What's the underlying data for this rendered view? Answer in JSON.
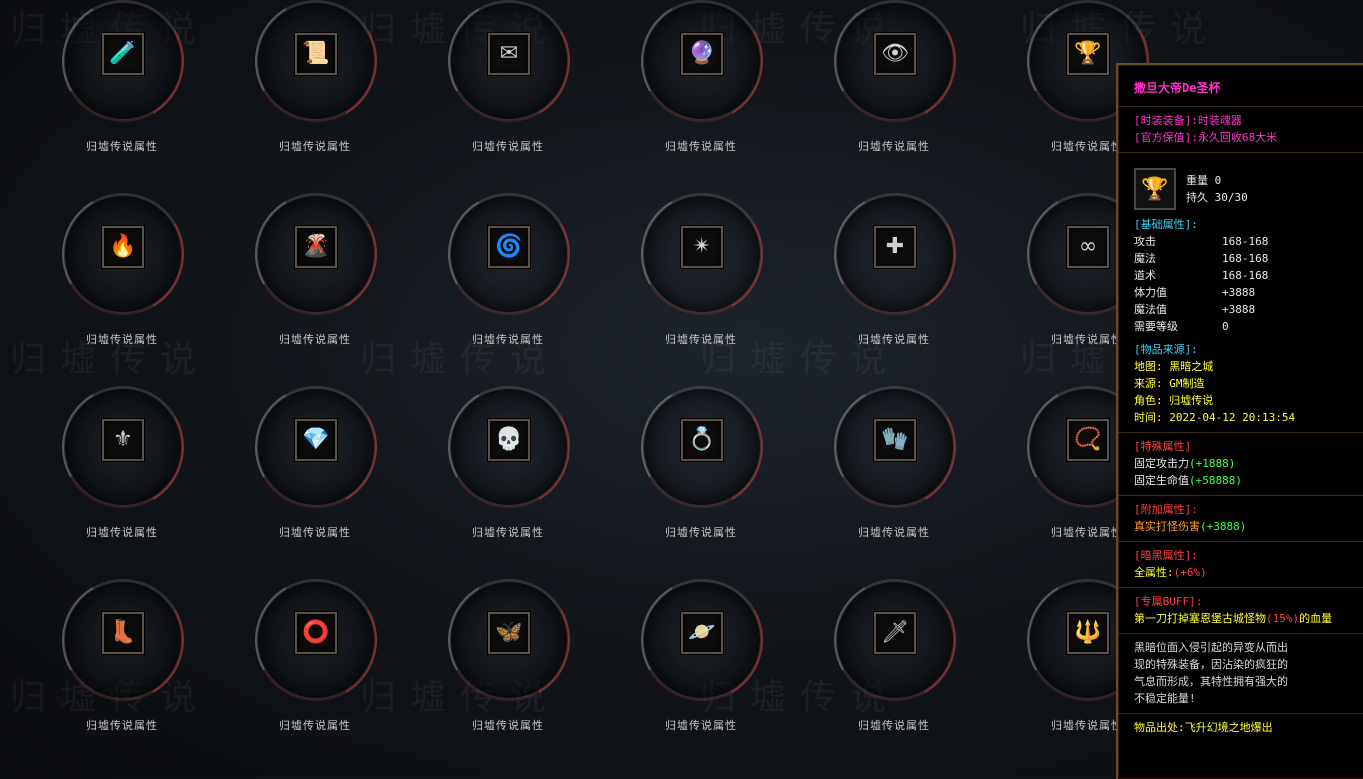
{
  "watermark_text": "归墟传说",
  "grid": {
    "label": "归墟传说属性",
    "rows": [
      [
        {
          "icon": "potion-icon",
          "glyph": "🧪"
        },
        {
          "icon": "scroll-icon",
          "glyph": "📜"
        },
        {
          "icon": "envelope-icon",
          "glyph": "✉"
        },
        {
          "icon": "crystal-orb-icon",
          "glyph": "🔮"
        },
        {
          "icon": "golden-eye-icon",
          "glyph": "👁"
        },
        {
          "icon": "chalice-icon",
          "glyph": "🏆"
        }
      ],
      [
        {
          "icon": "flame-rune-icon",
          "glyph": "🔥"
        },
        {
          "icon": "lava-rune-icon",
          "glyph": "🌋"
        },
        {
          "icon": "fire-orb-icon",
          "glyph": "🌀"
        },
        {
          "icon": "red-sigil-icon",
          "glyph": "✴"
        },
        {
          "icon": "cross-sigil-icon",
          "glyph": "✚"
        },
        {
          "icon": "infinity-sigil-icon",
          "glyph": "∞"
        }
      ],
      [
        {
          "icon": "winged-helm-icon",
          "glyph": "⚜"
        },
        {
          "icon": "pink-gem-icon",
          "glyph": "💎"
        },
        {
          "icon": "skull-ring-icon",
          "glyph": "💀"
        },
        {
          "icon": "amber-ring-icon",
          "glyph": "💍"
        },
        {
          "icon": "red-glove-icon",
          "glyph": "🧤"
        },
        {
          "icon": "gold-bracelet-icon",
          "glyph": "📿"
        }
      ],
      [
        {
          "icon": "boots-icon",
          "glyph": "👢"
        },
        {
          "icon": "jade-bracelet-icon",
          "glyph": "⭕"
        },
        {
          "icon": "cyan-claw-icon",
          "glyph": "🦋"
        },
        {
          "icon": "blue-orb-icon",
          "glyph": "🪐"
        },
        {
          "icon": "red-blade-icon",
          "glyph": "🗡"
        },
        {
          "icon": "dark-spear-icon",
          "glyph": "🔱"
        }
      ]
    ]
  },
  "tooltip": {
    "name": "撒旦大帝De圣杯",
    "equip_type": "[时装装备]:时装魂器",
    "value": "[官方保值]:永久回收68大米",
    "icon": "chalice-icon",
    "icon_glyph": "🏆",
    "weight_label": "重量",
    "weight_value": "0",
    "durability_label": "持久",
    "durability_value": "30/30",
    "base_title": "[基础属性]:",
    "base_stats": [
      {
        "k": "攻击",
        "v": "168-168"
      },
      {
        "k": "魔法",
        "v": "168-168"
      },
      {
        "k": "道术",
        "v": "168-168"
      },
      {
        "k": "体力值",
        "v": "+3888"
      },
      {
        "k": "魔法值",
        "v": "+3888"
      },
      {
        "k": "需要等级",
        "v": "0"
      }
    ],
    "source_title": "[物品来源]:",
    "source_lines": [
      "地图: 黑暗之城",
      "来源: GM制造",
      "角色: 归墟传说",
      "时间: 2022-04-12 20:13:54"
    ],
    "special_title": "[特殊属性]",
    "special": [
      {
        "k": "固定攻击力",
        "v": "(+1888)"
      },
      {
        "k": "固定生命值",
        "v": "(+58888)"
      }
    ],
    "extra_title": "[附加属性]:",
    "extra_k": "真实打怪伤害",
    "extra_v": "(+3888)",
    "dark_title": "[暗黑属性]:",
    "dark_k": "全属性:",
    "dark_v": "(+6%)",
    "buff_title": "[专属BUFF]:",
    "buff_a": "第一刀打掉塞恩堡古城怪物",
    "buff_b": "(15%)",
    "buff_c": "的血量",
    "desc_lines": [
      "黑暗位面入侵引起的异变从而出",
      "现的特殊装备，因沾染的疯狂的",
      "气息而形成，其特性拥有强大的",
      "不稳定能量!"
    ],
    "origin": "物品出处:飞升幻境之地爆出"
  }
}
